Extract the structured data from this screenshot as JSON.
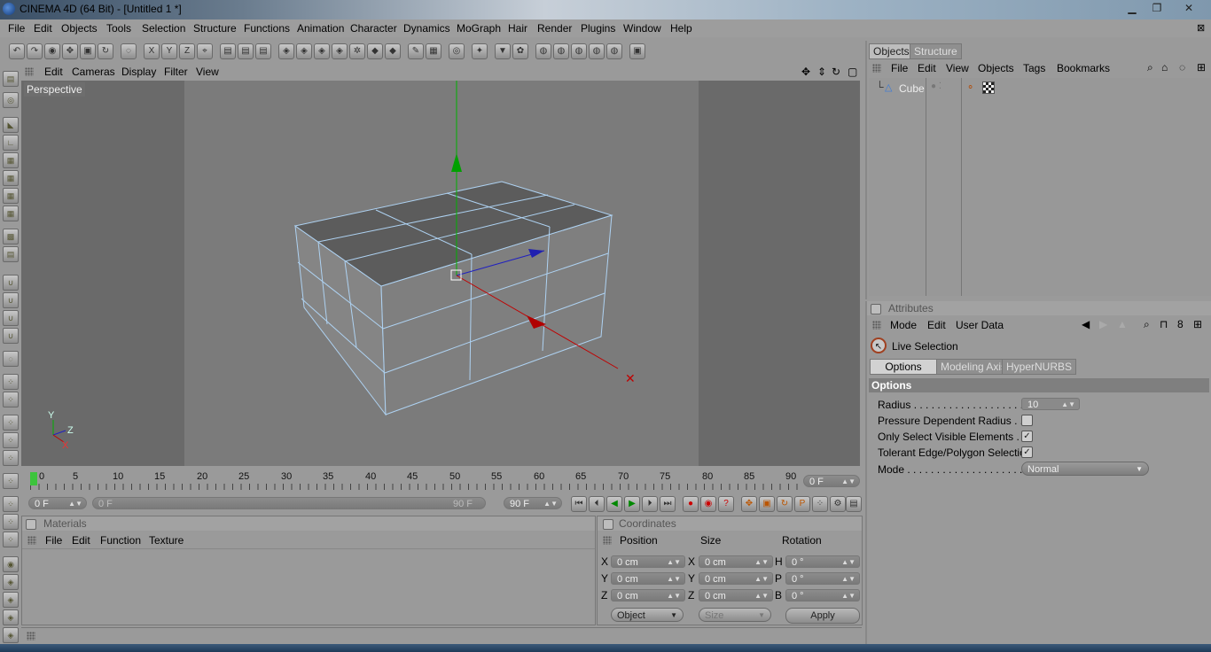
{
  "window": {
    "title": "CINEMA 4D (64 Bit) - [Untitled 1 *]",
    "controls": [
      "▁",
      "❐",
      "✕"
    ]
  },
  "menu": [
    "File",
    "Edit",
    "Objects",
    "Tools",
    "Selection",
    "Structure",
    "Functions",
    "Animation",
    "Character",
    "Dynamics",
    "MoGraph",
    "Hair",
    "Render",
    "Plugins",
    "Window",
    "Help"
  ],
  "viewport": {
    "menu": [
      "Edit",
      "Cameras",
      "Display",
      "Filter",
      "View"
    ],
    "label": "Perspective",
    "axis_labels": {
      "y": "Y",
      "z": "Z",
      "x": "X"
    }
  },
  "timeline": {
    "ticks": [
      "0",
      "5",
      "10",
      "15",
      "20",
      "25",
      "30",
      "35",
      "40",
      "45",
      "50",
      "55",
      "60",
      "65",
      "70",
      "75",
      "80",
      "85",
      "90"
    ],
    "current_frame": "0 F",
    "start_field": "0 F",
    "range_start": "0 F",
    "range_end": "90 F",
    "end_field": "90 F"
  },
  "materials": {
    "title": "Materials",
    "menu": [
      "File",
      "Edit",
      "Function",
      "Texture"
    ]
  },
  "coordinates": {
    "title": "Coordinates",
    "headers": [
      "Position",
      "Size",
      "Rotation"
    ],
    "rows": [
      {
        "a": "X",
        "pos": "0 cm",
        "b": "X",
        "size": "0 cm",
        "c": "H",
        "rot": "0 °"
      },
      {
        "a": "Y",
        "pos": "0 cm",
        "b": "Y",
        "size": "0 cm",
        "c": "P",
        "rot": "0 °"
      },
      {
        "a": "Z",
        "pos": "0 cm",
        "b": "Z",
        "size": "0 cm",
        "c": "B",
        "rot": "0 °"
      }
    ],
    "mode_select": "Object",
    "size_select": "Size",
    "apply": "Apply"
  },
  "objects_panel": {
    "tabs": [
      "Objects",
      "Structure"
    ],
    "menu": [
      "File",
      "Edit",
      "View",
      "Objects",
      "Tags",
      "Bookmarks"
    ],
    "items": [
      {
        "name": "Cube"
      }
    ]
  },
  "attributes_panel": {
    "title": "Attributes",
    "menu": [
      "Mode",
      "Edit",
      "User Data"
    ],
    "tool_name": "Live Selection",
    "tabs": [
      "Options",
      "Modeling Axis",
      "HyperNURBS"
    ],
    "section": "Options",
    "fields": {
      "radius_label": "Radius . . . . . . . . . . . . . . . . . . .",
      "radius_value": "10",
      "pressure_label": "Pressure Dependent Radius . . .",
      "pressure_checked": false,
      "visible_label": "Only Select Visible Elements  . . .",
      "visible_checked": true,
      "tolerant_label": "Tolerant Edge/Polygon Selection",
      "tolerant_checked": true,
      "mode_label": "Mode . . . . . . . . . . . . . . . . . . . .",
      "mode_value": "Normal"
    }
  },
  "colors": {
    "viewport_bg": "#6a6a6a",
    "viewport_inner": "#7b7b7b",
    "panel_bg": "#9a9a9a",
    "cube_face": "#808080",
    "cube_top": "#5f5f5f",
    "edge": "#aed2f2",
    "axis_x": "#c00000",
    "axis_y": "#00b000",
    "axis_z": "#2020c0"
  }
}
